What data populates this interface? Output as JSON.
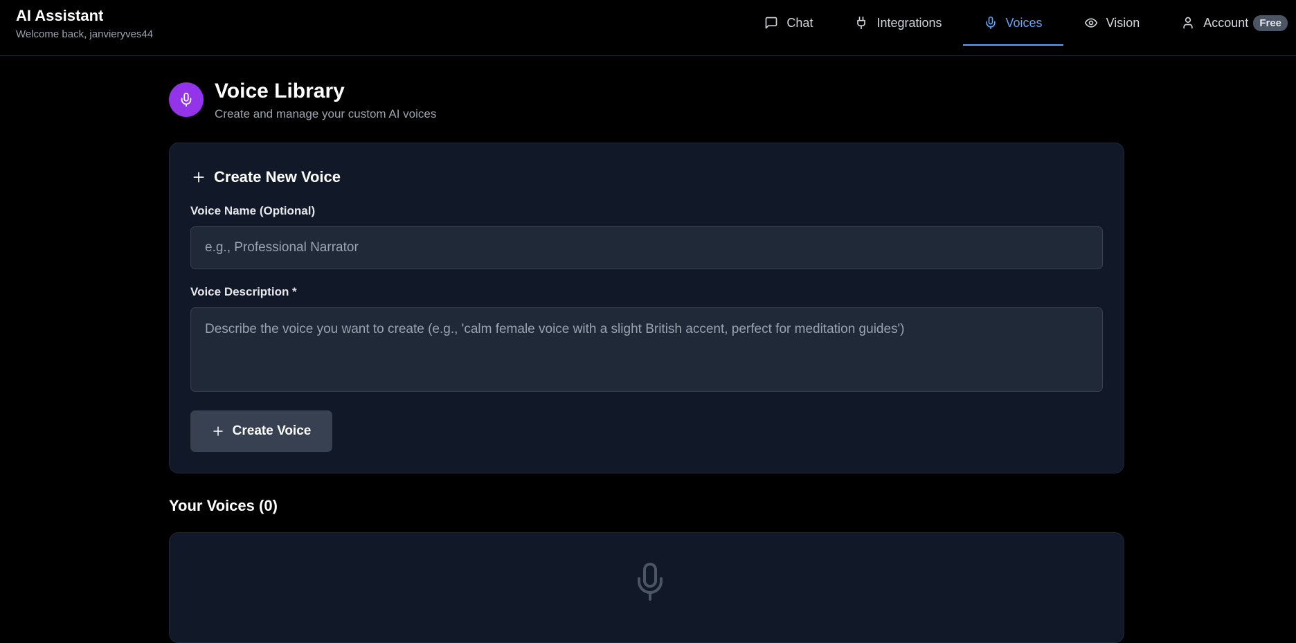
{
  "app": {
    "title": "AI Assistant",
    "welcome": "Welcome back, janvieryves44"
  },
  "nav": {
    "items": [
      {
        "label": "Chat",
        "icon": "chat-bubble-icon"
      },
      {
        "label": "Integrations",
        "icon": "plug-icon"
      },
      {
        "label": "Voices",
        "icon": "microphone-icon",
        "active": true
      },
      {
        "label": "Vision",
        "icon": "eye-icon"
      },
      {
        "label": "Account",
        "icon": "user-icon"
      }
    ],
    "plan_badge": "Free"
  },
  "page": {
    "title": "Voice Library",
    "subtitle": "Create and manage your custom AI voices"
  },
  "create_form": {
    "heading": "Create New Voice",
    "name_label": "Voice Name (Optional)",
    "name_placeholder": "e.g., Professional Narrator",
    "name_value": "",
    "description_label": "Voice Description *",
    "description_placeholder": "Describe the voice you want to create (e.g., 'calm female voice with a slight British accent, perfect for meditation guides')",
    "description_value": "",
    "submit_label": "Create Voice"
  },
  "voices": {
    "heading": "Your Voices (0)"
  },
  "colors": {
    "background": "#000000",
    "card": "#111827",
    "input": "#1f2937",
    "accent_blue": "#60a5fa",
    "accent_purple": "#9333ea",
    "button": "#374151"
  }
}
